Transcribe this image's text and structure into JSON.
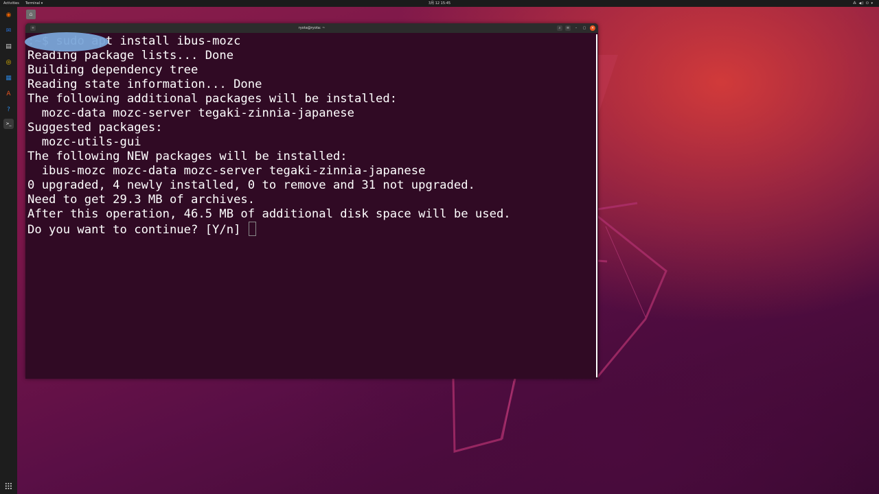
{
  "topbar": {
    "activities": "Activities",
    "app_menu": "Terminal ▾",
    "clock": "3月 12 15:45",
    "tray": "⁂ ◀) ⏻ ▾"
  },
  "terminal": {
    "title": "ryota@ryota: ~",
    "prompt_host": "",
    "prompt_sep": ":",
    "prompt_path": "~",
    "prompt_symbol": "$ ",
    "command": "sudo apt install ibus-mozc",
    "output": [
      "Reading package lists... Done",
      "Building dependency tree",
      "Reading state information... Done",
      "The following additional packages will be installed:",
      "  mozc-data mozc-server tegaki-zinnia-japanese",
      "Suggested packages:",
      "  mozc-utils-gui",
      "The following NEW packages will be installed:",
      "  ibus-mozc mozc-data mozc-server tegaki-zinnia-japanese",
      "0 upgraded, 4 newly installed, 0 to remove and 31 not upgraded.",
      "Need to get 29.3 MB of archives.",
      "After this operation, 46.5 MB of additional disk space will be used."
    ],
    "question": "Do you want to continue? [Y/n] "
  },
  "dock": {
    "items": [
      {
        "name": "firefox-icon",
        "glyph": "◉",
        "color": "#e66000"
      },
      {
        "name": "thunderbird-icon",
        "glyph": "✉",
        "color": "#2a72d8"
      },
      {
        "name": "files-icon",
        "glyph": "▤",
        "color": "#cfcfcf"
      },
      {
        "name": "rhythmbox-icon",
        "glyph": "◎",
        "color": "#f2c500"
      },
      {
        "name": "libreoffice-writer-icon",
        "glyph": "▦",
        "color": "#2a7fd4"
      },
      {
        "name": "software-center-icon",
        "glyph": "A",
        "color": "#e95420"
      },
      {
        "name": "help-icon",
        "glyph": "?",
        "color": "#2e8ae6"
      },
      {
        "name": "terminal-icon",
        "glyph": ">_",
        "color": "#3a3a3a"
      }
    ]
  },
  "colors": {
    "terminal_bg": "#300a24",
    "prompt_user": "#8ae234",
    "prompt_path": "#729fcf",
    "close_button": "#e9541f"
  }
}
